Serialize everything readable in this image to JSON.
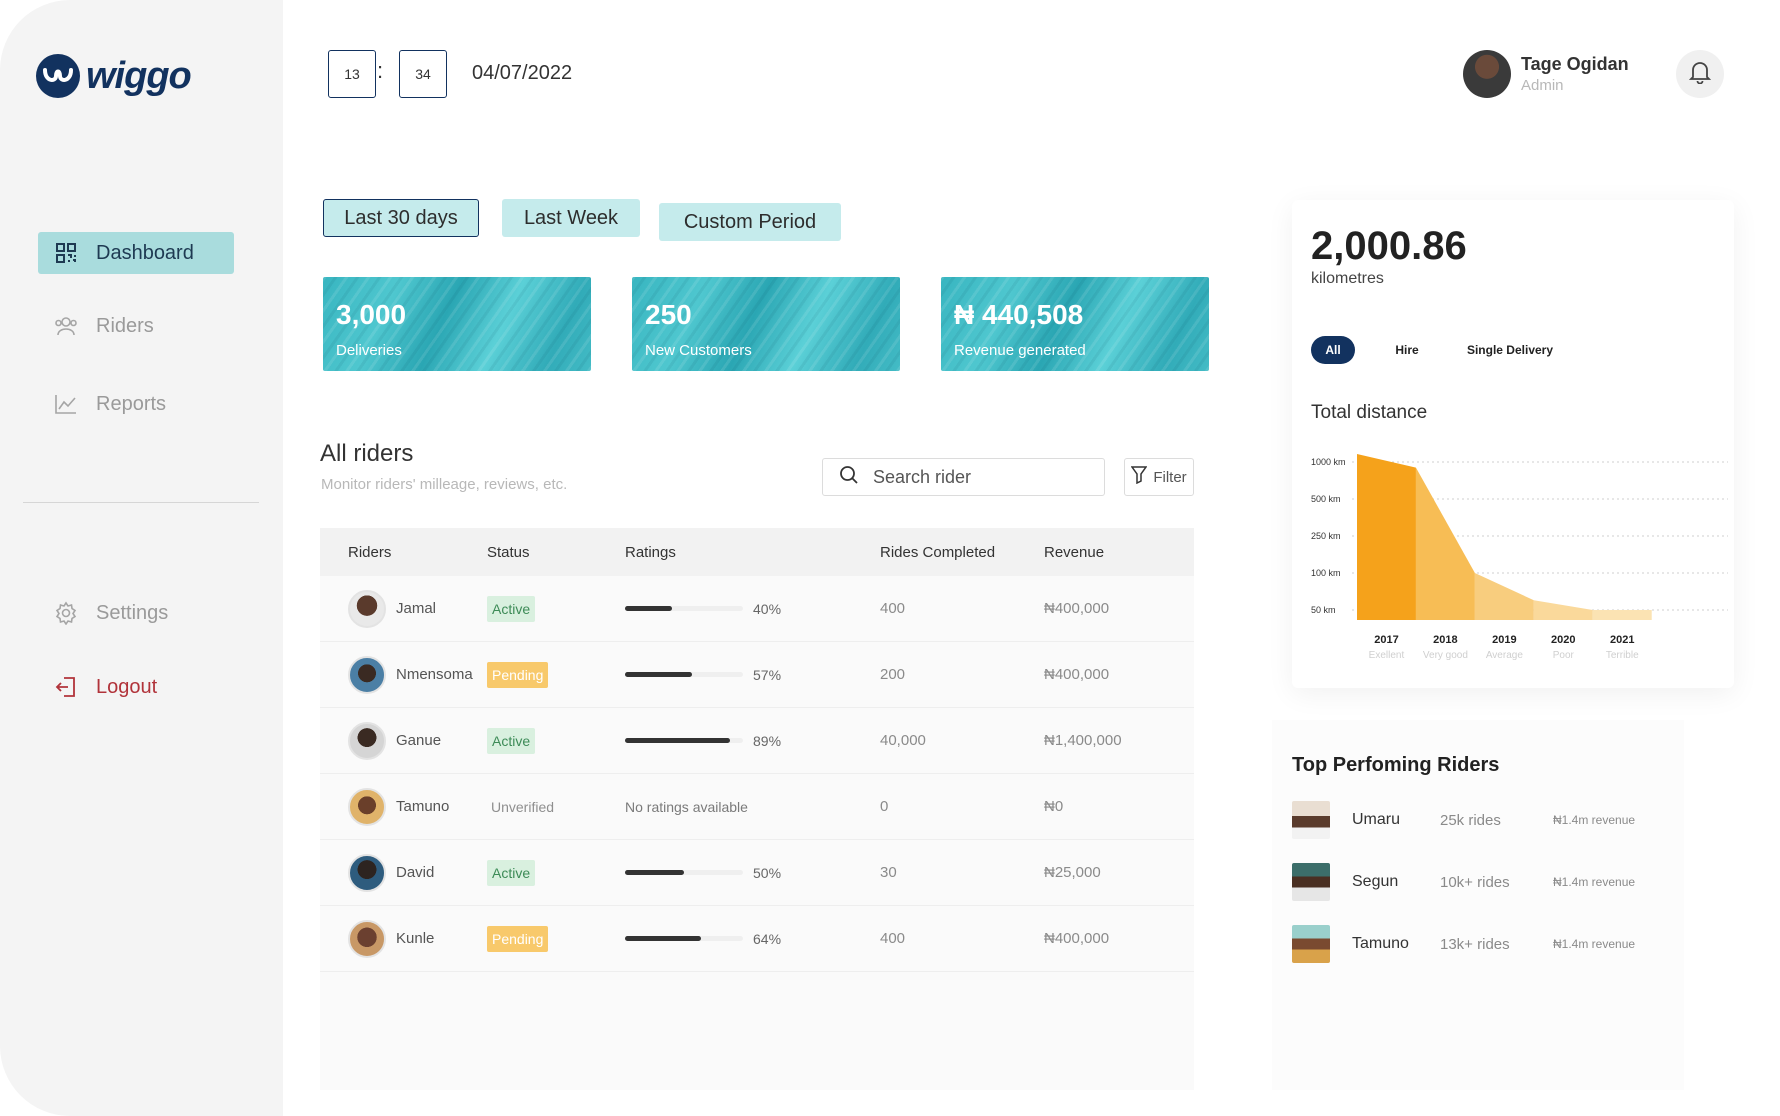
{
  "app": {
    "logo_text": "wiggo"
  },
  "sidebar": {
    "items": [
      {
        "label": "Dashboard",
        "icon": "grid-icon"
      },
      {
        "label": "Riders",
        "icon": "users-icon"
      },
      {
        "label": "Reports",
        "icon": "line-chart-icon"
      },
      {
        "label": "Settings",
        "icon": "gear-icon"
      },
      {
        "label": "Logout",
        "icon": "logout-icon"
      }
    ],
    "active_index": 0
  },
  "header": {
    "time_hours": "13",
    "time_sep": ":",
    "time_minutes": "34",
    "date": "04/07/2022",
    "user_name": "Tage Ogidan",
    "user_role": "Admin"
  },
  "periods": [
    "Last 30 days",
    "Last Week",
    "Custom Period"
  ],
  "stats": [
    {
      "value": "3,000",
      "label": "Deliveries"
    },
    {
      "value": "250",
      "label": "New Customers"
    },
    {
      "value": "₦ 440,508",
      "label": "Revenue generated"
    }
  ],
  "riders_section": {
    "title": "All riders",
    "subtitle": "Monitor riders' milleage, reviews, etc.",
    "search_placeholder": "Search  rider",
    "filter_label": "Filter",
    "columns": [
      "Riders",
      "Status",
      "Ratings",
      "Rides Completed",
      "Revenue"
    ],
    "rows": [
      {
        "name": "Jamal",
        "status": "Active",
        "status_type": "active",
        "rating": 0.4,
        "rating_label": "40%",
        "rides": "400",
        "revenue": "₦400,000"
      },
      {
        "name": "Nmensoma",
        "status": "Pending",
        "status_type": "pending",
        "rating": 0.57,
        "rating_label": "57%",
        "rides": "200",
        "revenue": "₦400,000"
      },
      {
        "name": "Ganue",
        "status": "Active",
        "status_type": "active",
        "rating": 0.89,
        "rating_label": "89%",
        "rides": "40,000",
        "revenue": "₦1,400,000"
      },
      {
        "name": "Tamuno",
        "status": "Unverified",
        "status_type": "unverified",
        "rating": null,
        "rating_label": "No ratings available",
        "rides": "0",
        "revenue": "₦0"
      },
      {
        "name": "David",
        "status": "Active",
        "status_type": "active",
        "rating": 0.5,
        "rating_label": "50%",
        "rides": "30",
        "revenue": "₦25,000"
      },
      {
        "name": "Kunle",
        "status": "Pending",
        "status_type": "pending",
        "rating": 0.64,
        "rating_label": "64%",
        "rides": "400",
        "revenue": "₦400,000"
      }
    ]
  },
  "distance": {
    "value": "2,000.86",
    "unit": "kilometres",
    "tabs": [
      "All",
      "Hire",
      "Single Delivery"
    ],
    "active_tab": 0,
    "chart_title": "Total distance"
  },
  "chart_data": {
    "type": "area",
    "title": "Total distance",
    "y_ticks": [
      "1000 km",
      "500 km",
      "250 km",
      "100 km",
      "50 km"
    ],
    "categories": [
      "2017",
      "2018",
      "2019",
      "2020",
      "2021"
    ],
    "category_sublabels": [
      "Exellent",
      "Very good",
      "Average",
      "Poor",
      "Terrible"
    ],
    "values_km": [
      1000,
      900,
      100,
      60,
      50
    ],
    "colors": [
      "#f5a21b",
      "#f7bd55",
      "#f8cd7e",
      "#fad99b",
      "#fbe3b3"
    ],
    "grid": true
  },
  "top_riders": {
    "title": "Top Perfoming Riders",
    "items": [
      {
        "name": "Umaru",
        "rides": "25k rides",
        "revenue": "₦1.4m revenue"
      },
      {
        "name": "Segun",
        "rides": "10k+ rides",
        "revenue": "₦1.4m revenue"
      },
      {
        "name": "Tamuno",
        "rides": "13k+ rides",
        "revenue": "₦1.4m revenue"
      }
    ]
  },
  "colors": {
    "brand": "#12325f",
    "accent_teal": "#a9dcdd",
    "active_badge": "#d9f0df",
    "pending_badge": "#f8c96b",
    "logout": "#b1333a",
    "chart_orange": "#f5a21b"
  }
}
